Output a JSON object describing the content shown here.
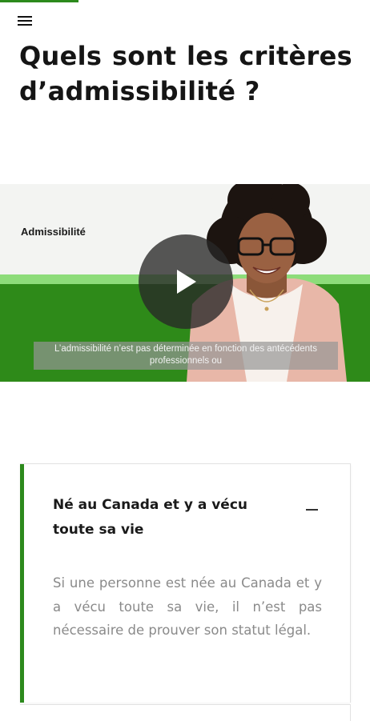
{
  "header": {
    "menu_icon": "hamburger-menu-icon",
    "accent_color": "#2c8a1c"
  },
  "page": {
    "title": "Quels sont les critères d’admissibilité ?"
  },
  "video": {
    "label": "Admissibilité",
    "caption": "L’admissibilité n’est pas déterminée en fonction des antécédents professionnels ou",
    "play_icon": "play-icon",
    "colors": {
      "band_light": "#8ddc7a",
      "band_green": "#2e8a19"
    }
  },
  "accordion": {
    "items": [
      {
        "heading": "Né au Canada et y a vécu toute sa vie",
        "toggle_icon": "minus-collapse-icon",
        "expanded": true,
        "body": "Si une personne est née au Canada et y a vécu toute sa vie, il n’est pas nécessaire de prouver son statut légal."
      }
    ]
  }
}
